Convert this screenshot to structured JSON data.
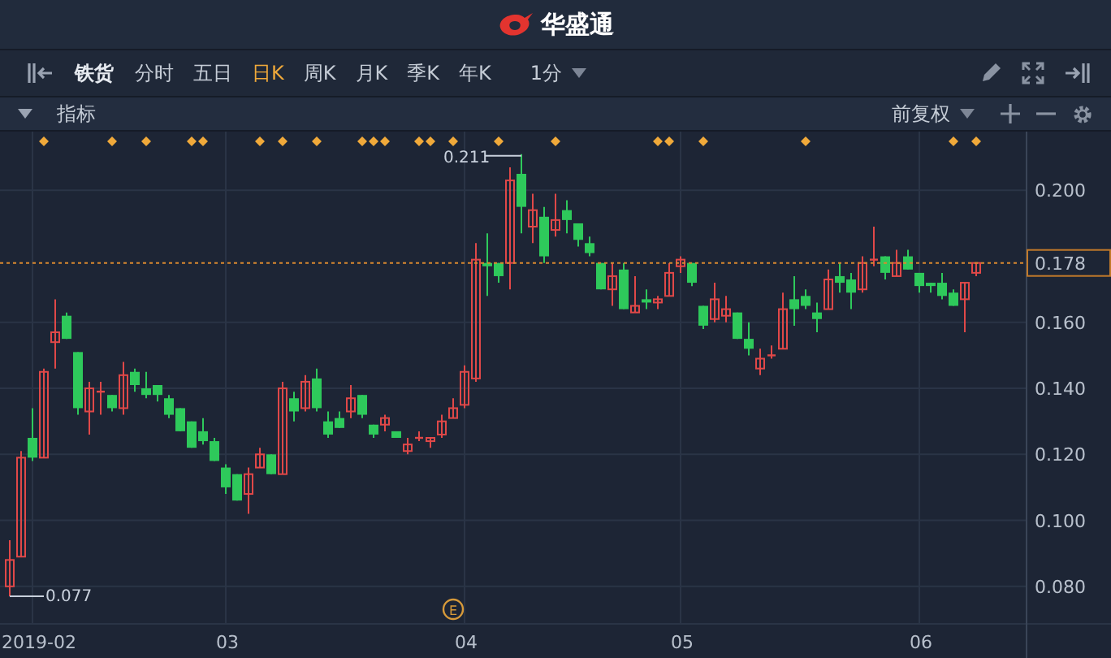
{
  "app": {
    "title": "华盛通"
  },
  "toolbar": {
    "symbol": "铁货",
    "tabs": [
      {
        "label": "分时",
        "selected": false
      },
      {
        "label": "五日",
        "selected": false
      },
      {
        "label": "日K",
        "selected": true
      },
      {
        "label": "周K",
        "selected": false
      },
      {
        "label": "月K",
        "selected": false
      },
      {
        "label": "季K",
        "selected": false
      },
      {
        "label": "年K",
        "selected": false
      }
    ],
    "interval": "1分"
  },
  "indicator_bar": {
    "label": "指标",
    "adjustment": "前复权"
  },
  "chart": {
    "high_label": "0.211",
    "low_label": "0.077",
    "earnings_badge": "E",
    "chart_data": {
      "type": "candlestick",
      "ylim": [
        0.0578,
        0.2178
      ],
      "grid": true,
      "yticks": [
        {
          "value": 0.2,
          "label": "0.200"
        },
        {
          "value": 0.16,
          "label": "0.160"
        },
        {
          "value": 0.14,
          "label": "0.140"
        },
        {
          "value": 0.12,
          "label": "0.120"
        },
        {
          "value": 0.1,
          "label": "0.100"
        },
        {
          "value": 0.08,
          "label": "0.080"
        }
      ],
      "categories": [
        null,
        null,
        "2019-02",
        null,
        null,
        null,
        null,
        null,
        null,
        null,
        null,
        null,
        null,
        null,
        null,
        null,
        null,
        null,
        null,
        "03",
        null,
        null,
        null,
        null,
        null,
        null,
        null,
        null,
        null,
        null,
        null,
        null,
        null,
        null,
        null,
        null,
        null,
        null,
        null,
        null,
        "04",
        null,
        null,
        null,
        null,
        null,
        null,
        null,
        null,
        null,
        null,
        null,
        null,
        null,
        null,
        null,
        null,
        null,
        null,
        "05",
        null,
        null,
        null,
        null,
        null,
        null,
        null,
        null,
        null,
        null,
        null,
        null,
        null,
        null,
        null,
        null,
        null,
        null,
        null,
        null,
        "06",
        null,
        null,
        null,
        null,
        null
      ],
      "ohlc": [
        [
          0.08,
          0.094,
          0.077,
          0.088
        ],
        [
          0.089,
          0.121,
          0.089,
          0.119
        ],
        [
          0.125,
          0.134,
          0.118,
          0.119
        ],
        [
          0.119,
          0.146,
          0.119,
          0.145
        ],
        [
          0.154,
          0.167,
          0.146,
          0.157
        ],
        [
          0.162,
          0.163,
          0.155,
          0.155
        ],
        [
          0.151,
          0.151,
          0.132,
          0.134
        ],
        [
          0.133,
          0.142,
          0.126,
          0.14
        ],
        [
          0.139,
          0.142,
          0.132,
          0.139
        ],
        [
          0.138,
          0.138,
          0.133,
          0.134
        ],
        [
          0.134,
          0.148,
          0.132,
          0.144
        ],
        [
          0.145,
          0.146,
          0.139,
          0.141
        ],
        [
          0.14,
          0.145,
          0.137,
          0.138
        ],
        [
          0.141,
          0.141,
          0.136,
          0.138
        ],
        [
          0.137,
          0.138,
          0.131,
          0.132
        ],
        [
          0.134,
          0.134,
          0.127,
          0.127
        ],
        [
          0.13,
          0.13,
          0.122,
          0.122
        ],
        [
          0.127,
          0.131,
          0.123,
          0.124
        ],
        [
          0.124,
          0.125,
          0.118,
          0.118
        ],
        [
          0.116,
          0.117,
          0.108,
          0.11
        ],
        [
          0.114,
          0.114,
          0.106,
          0.106
        ],
        [
          0.108,
          0.116,
          0.102,
          0.114
        ],
        [
          0.116,
          0.122,
          0.116,
          0.12
        ],
        [
          0.12,
          0.12,
          0.114,
          0.114
        ],
        [
          0.114,
          0.142,
          0.114,
          0.14
        ],
        [
          0.137,
          0.139,
          0.13,
          0.133
        ],
        [
          0.134,
          0.144,
          0.133,
          0.142
        ],
        [
          0.143,
          0.146,
          0.133,
          0.134
        ],
        [
          0.13,
          0.133,
          0.125,
          0.126
        ],
        [
          0.131,
          0.133,
          0.128,
          0.128
        ],
        [
          0.133,
          0.141,
          0.131,
          0.137
        ],
        [
          0.138,
          0.138,
          0.131,
          0.132
        ],
        [
          0.129,
          0.129,
          0.125,
          0.126
        ],
        [
          0.129,
          0.132,
          0.127,
          0.131
        ],
        [
          0.127,
          0.127,
          0.125,
          0.125
        ],
        [
          0.121,
          0.125,
          0.12,
          0.123
        ],
        [
          0.125,
          0.127,
          0.124,
          0.125
        ],
        [
          0.124,
          0.125,
          0.122,
          0.125
        ],
        [
          0.126,
          0.132,
          0.125,
          0.13
        ],
        [
          0.131,
          0.137,
          0.131,
          0.134
        ],
        [
          0.135,
          0.147,
          0.134,
          0.145
        ],
        [
          0.143,
          0.184,
          0.142,
          0.179
        ],
        [
          0.178,
          0.187,
          0.168,
          0.177
        ],
        [
          0.178,
          0.178,
          0.172,
          0.174
        ],
        [
          0.178,
          0.207,
          0.17,
          0.203
        ],
        [
          0.205,
          0.211,
          0.187,
          0.195
        ],
        [
          0.189,
          0.199,
          0.184,
          0.194
        ],
        [
          0.192,
          0.195,
          0.178,
          0.18
        ],
        [
          0.188,
          0.199,
          0.186,
          0.191
        ],
        [
          0.194,
          0.197,
          0.187,
          0.191
        ],
        [
          0.19,
          0.19,
          0.183,
          0.185
        ],
        [
          0.184,
          0.186,
          0.18,
          0.181
        ],
        [
          0.178,
          0.178,
          0.17,
          0.17
        ],
        [
          0.17,
          0.178,
          0.165,
          0.174
        ],
        [
          0.176,
          0.178,
          0.164,
          0.164
        ],
        [
          0.163,
          0.174,
          0.163,
          0.165
        ],
        [
          0.167,
          0.17,
          0.164,
          0.166
        ],
        [
          0.166,
          0.168,
          0.164,
          0.167
        ],
        [
          0.168,
          0.178,
          0.168,
          0.175
        ],
        [
          0.177,
          0.18,
          0.175,
          0.179
        ],
        [
          0.178,
          0.178,
          0.171,
          0.172
        ],
        [
          0.165,
          0.165,
          0.158,
          0.159
        ],
        [
          0.161,
          0.172,
          0.16,
          0.167
        ],
        [
          0.162,
          0.168,
          0.16,
          0.164
        ],
        [
          0.163,
          0.163,
          0.155,
          0.155
        ],
        [
          0.155,
          0.16,
          0.15,
          0.152
        ],
        [
          0.146,
          0.152,
          0.144,
          0.149
        ],
        [
          0.15,
          0.153,
          0.149,
          0.15
        ],
        [
          0.152,
          0.169,
          0.152,
          0.164
        ],
        [
          0.167,
          0.174,
          0.159,
          0.164
        ],
        [
          0.168,
          0.17,
          0.164,
          0.165
        ],
        [
          0.163,
          0.166,
          0.157,
          0.161
        ],
        [
          0.164,
          0.176,
          0.164,
          0.173
        ],
        [
          0.174,
          0.178,
          0.169,
          0.172
        ],
        [
          0.173,
          0.175,
          0.164,
          0.169
        ],
        [
          0.17,
          0.18,
          0.169,
          0.178
        ],
        [
          0.179,
          0.189,
          0.177,
          0.179
        ],
        [
          0.18,
          0.18,
          0.173,
          0.175
        ],
        [
          0.174,
          0.182,
          0.174,
          0.178
        ],
        [
          0.18,
          0.182,
          0.176,
          0.176
        ],
        [
          0.175,
          0.175,
          0.169,
          0.171
        ],
        [
          0.172,
          0.172,
          0.169,
          0.171
        ],
        [
          0.172,
          0.175,
          0.167,
          0.168
        ],
        [
          0.169,
          0.17,
          0.165,
          0.165
        ],
        [
          0.167,
          0.172,
          0.157,
          0.172
        ],
        [
          0.175,
          0.178,
          0.174,
          0.178
        ]
      ],
      "ref_lines": [
        {
          "axis": "y",
          "value": 0.178,
          "label": "0.178",
          "color": "#d9892f"
        }
      ]
    }
  }
}
